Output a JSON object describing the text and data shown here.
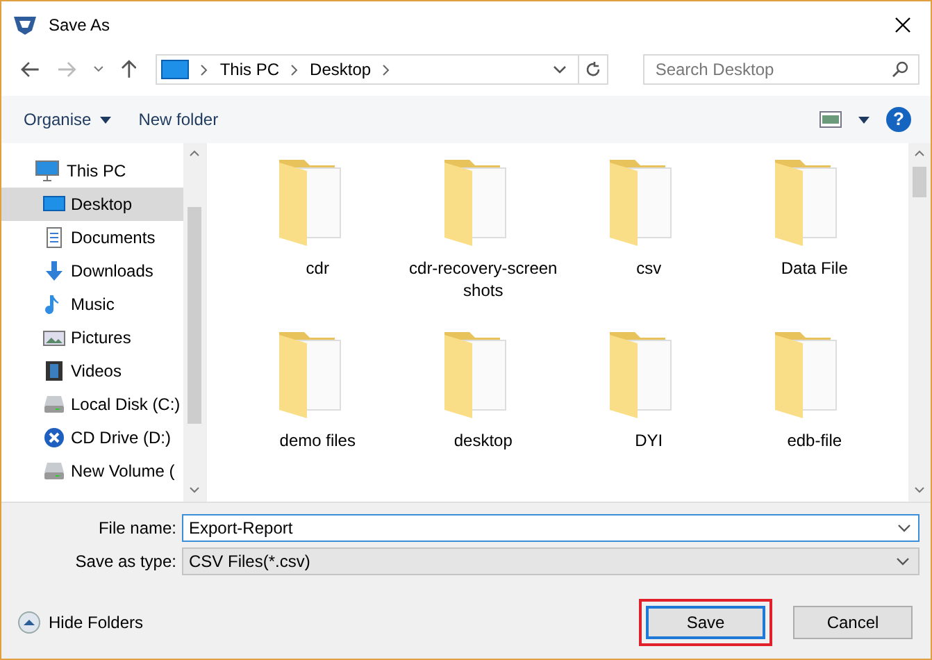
{
  "window": {
    "title": "Save As"
  },
  "navigation": {
    "breadcrumbs": [
      "This PC",
      "Desktop"
    ],
    "search": {
      "placeholder": "Search Desktop"
    }
  },
  "toolbar": {
    "organise": "Organise",
    "new_folder": "New folder",
    "help": "?"
  },
  "sidebar": {
    "items": [
      {
        "label": "This PC",
        "kind": "pc",
        "selected": false,
        "children": [
          {
            "label": "Desktop",
            "kind": "desktop",
            "selected": true
          },
          {
            "label": "Documents",
            "kind": "documents",
            "selected": false
          },
          {
            "label": "Downloads",
            "kind": "downloads",
            "selected": false
          },
          {
            "label": "Music",
            "kind": "music",
            "selected": false
          },
          {
            "label": "Pictures",
            "kind": "pictures",
            "selected": false
          },
          {
            "label": "Videos",
            "kind": "videos",
            "selected": false
          },
          {
            "label": "Local Disk (C:)",
            "kind": "disk",
            "selected": false
          },
          {
            "label": "CD Drive (D:)",
            "kind": "cd",
            "selected": false
          },
          {
            "label": "New Volume (",
            "kind": "disk",
            "selected": false
          }
        ]
      }
    ]
  },
  "folders": [
    {
      "name": "cdr"
    },
    {
      "name": "cdr-recovery-screenshots"
    },
    {
      "name": "csv"
    },
    {
      "name": "Data File"
    },
    {
      "name": "demo files"
    },
    {
      "name": "desktop"
    },
    {
      "name": "DYI"
    },
    {
      "name": "edb-file"
    }
  ],
  "form": {
    "file_name_label": "File name:",
    "file_name": "Export-Report",
    "type_label": "Save as type:",
    "type": "CSV Files(*.csv)"
  },
  "hide_folders": "Hide Folders",
  "buttons": [
    {
      "label": "Save",
      "default": true,
      "highlighted": true
    },
    {
      "label": "Cancel",
      "default": false,
      "highlighted": false
    }
  ]
}
